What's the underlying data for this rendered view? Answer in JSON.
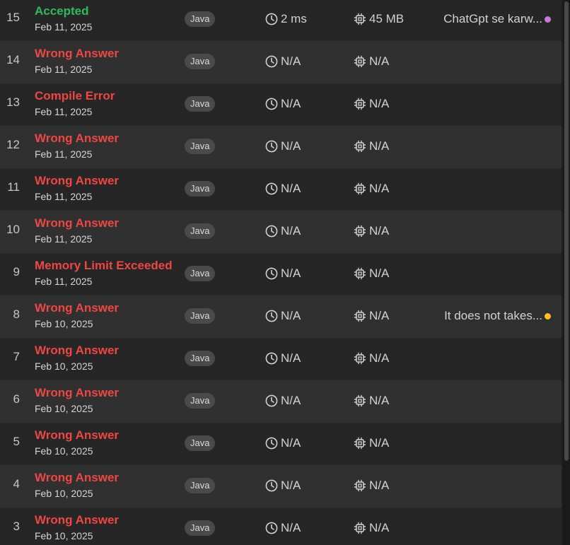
{
  "submissions": [
    {
      "index": "15",
      "status": "Accepted",
      "status_type": "ok",
      "date": "Feb 11, 2025",
      "language": "Java",
      "runtime": "2 ms",
      "memory": "45 MB",
      "note": "ChatGpt se karw...",
      "note_color": "#c678dd"
    },
    {
      "index": "14",
      "status": "Wrong Answer",
      "status_type": "bad",
      "date": "Feb 11, 2025",
      "language": "Java",
      "runtime": "N/A",
      "memory": "N/A",
      "note": "",
      "note_color": ""
    },
    {
      "index": "13",
      "status": "Compile Error",
      "status_type": "bad",
      "date": "Feb 11, 2025",
      "language": "Java",
      "runtime": "N/A",
      "memory": "N/A",
      "note": "",
      "note_color": ""
    },
    {
      "index": "12",
      "status": "Wrong Answer",
      "status_type": "bad",
      "date": "Feb 11, 2025",
      "language": "Java",
      "runtime": "N/A",
      "memory": "N/A",
      "note": "",
      "note_color": ""
    },
    {
      "index": "11",
      "status": "Wrong Answer",
      "status_type": "bad",
      "date": "Feb 11, 2025",
      "language": "Java",
      "runtime": "N/A",
      "memory": "N/A",
      "note": "",
      "note_color": ""
    },
    {
      "index": "10",
      "status": "Wrong Answer",
      "status_type": "bad",
      "date": "Feb 11, 2025",
      "language": "Java",
      "runtime": "N/A",
      "memory": "N/A",
      "note": "",
      "note_color": ""
    },
    {
      "index": "9",
      "status": "Memory Limit Exceeded",
      "status_type": "bad",
      "date": "Feb 11, 2025",
      "language": "Java",
      "runtime": "N/A",
      "memory": "N/A",
      "note": "",
      "note_color": ""
    },
    {
      "index": "8",
      "status": "Wrong Answer",
      "status_type": "bad",
      "date": "Feb 10, 2025",
      "language": "Java",
      "runtime": "N/A",
      "memory": "N/A",
      "note": "It does not takes...",
      "note_color": "#ffc01e"
    },
    {
      "index": "7",
      "status": "Wrong Answer",
      "status_type": "bad",
      "date": "Feb 10, 2025",
      "language": "Java",
      "runtime": "N/A",
      "memory": "N/A",
      "note": "",
      "note_color": ""
    },
    {
      "index": "6",
      "status": "Wrong Answer",
      "status_type": "bad",
      "date": "Feb 10, 2025",
      "language": "Java",
      "runtime": "N/A",
      "memory": "N/A",
      "note": "",
      "note_color": ""
    },
    {
      "index": "5",
      "status": "Wrong Answer",
      "status_type": "bad",
      "date": "Feb 10, 2025",
      "language": "Java",
      "runtime": "N/A",
      "memory": "N/A",
      "note": "",
      "note_color": ""
    },
    {
      "index": "4",
      "status": "Wrong Answer",
      "status_type": "bad",
      "date": "Feb 10, 2025",
      "language": "Java",
      "runtime": "N/A",
      "memory": "N/A",
      "note": "",
      "note_color": ""
    },
    {
      "index": "3",
      "status": "Wrong Answer",
      "status_type": "bad",
      "date": "Feb 10, 2025",
      "language": "Java",
      "runtime": "N/A",
      "memory": "N/A",
      "note": "",
      "note_color": ""
    }
  ],
  "icons": {
    "runtime": "clock-icon",
    "memory": "chip-icon"
  },
  "colors": {
    "accepted": "#2cbb5d",
    "error": "#ef4743"
  }
}
